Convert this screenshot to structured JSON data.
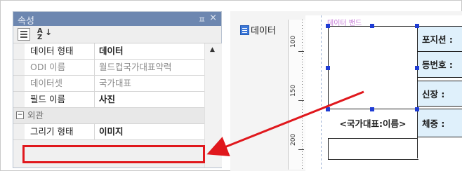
{
  "panel": {
    "title": "속성",
    "pin_glyph": "ㅍ",
    "close_glyph": "×",
    "sort_icon_text": "A\nZ",
    "rows": [
      {
        "label": "데이터 형태",
        "value": "데이터",
        "dim": false,
        "bold_value": true
      },
      {
        "label": "ODI 이름",
        "value": "월드컵국가대표약력",
        "dim": true,
        "bold_value": false
      },
      {
        "label": "데이터셋",
        "value": "국가대표",
        "dim": true,
        "bold_value": false
      },
      {
        "label": "필드 이름",
        "value": "사진",
        "dim": false,
        "bold_value": true
      }
    ],
    "category": {
      "toggle": "−",
      "label": "외관"
    },
    "highlight_row": {
      "label": "그리기 형태",
      "value": "이미지"
    }
  },
  "designer": {
    "data_button_label": "데이터",
    "band_label": "데이터 밴드",
    "ruler_labels": [
      "100",
      "150",
      "200"
    ],
    "image_field_text": "<국가대표:이름>",
    "cells": [
      "포지션 :",
      "등번호 :",
      "신장 :",
      "체중 :"
    ]
  },
  "colors": {
    "title_bar": "#6d87b0",
    "highlight": "#e0181d",
    "selection": "#1f3cd4",
    "cell_fill": "#dff0fb"
  }
}
